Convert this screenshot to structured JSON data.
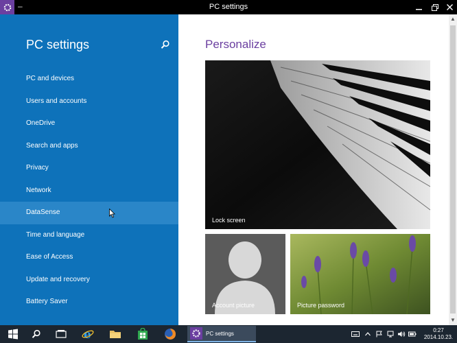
{
  "window": {
    "title": "PC settings",
    "minimize_glyph": "–"
  },
  "sidebar": {
    "title": "PC settings",
    "items": [
      {
        "label": "PC and devices"
      },
      {
        "label": "Users and accounts"
      },
      {
        "label": "OneDrive"
      },
      {
        "label": "Search and apps"
      },
      {
        "label": "Privacy"
      },
      {
        "label": "Network"
      },
      {
        "label": "DataSense"
      },
      {
        "label": "Time and language"
      },
      {
        "label": "Ease of Access"
      },
      {
        "label": "Update and recovery"
      },
      {
        "label": "Battery Saver"
      }
    ],
    "hovered_item": "DataSense"
  },
  "main": {
    "heading": "Personalize",
    "tiles": [
      {
        "label": "Lock screen"
      },
      {
        "label": "Account picture"
      },
      {
        "label": "Picture password"
      }
    ]
  },
  "taskbar": {
    "active_app_label": "PC settings",
    "clock_time": "0:27",
    "clock_date": "2014.10.23."
  },
  "colors": {
    "sidebar_bg": "#0e72ba",
    "hover_bg": "#2a86c8",
    "accent": "#6b3fa0",
    "taskbar_bg": "#1c2631"
  },
  "icons": [
    "gear-icon",
    "search-icon",
    "start-icon",
    "taskbar-search-icon",
    "task-view-icon",
    "internet-explorer-icon",
    "file-explorer-icon",
    "store-icon",
    "firefox-icon",
    "keyboard-icon",
    "chevron-up-icon",
    "flag-icon",
    "network-icon",
    "volume-icon",
    "battery-icon"
  ]
}
